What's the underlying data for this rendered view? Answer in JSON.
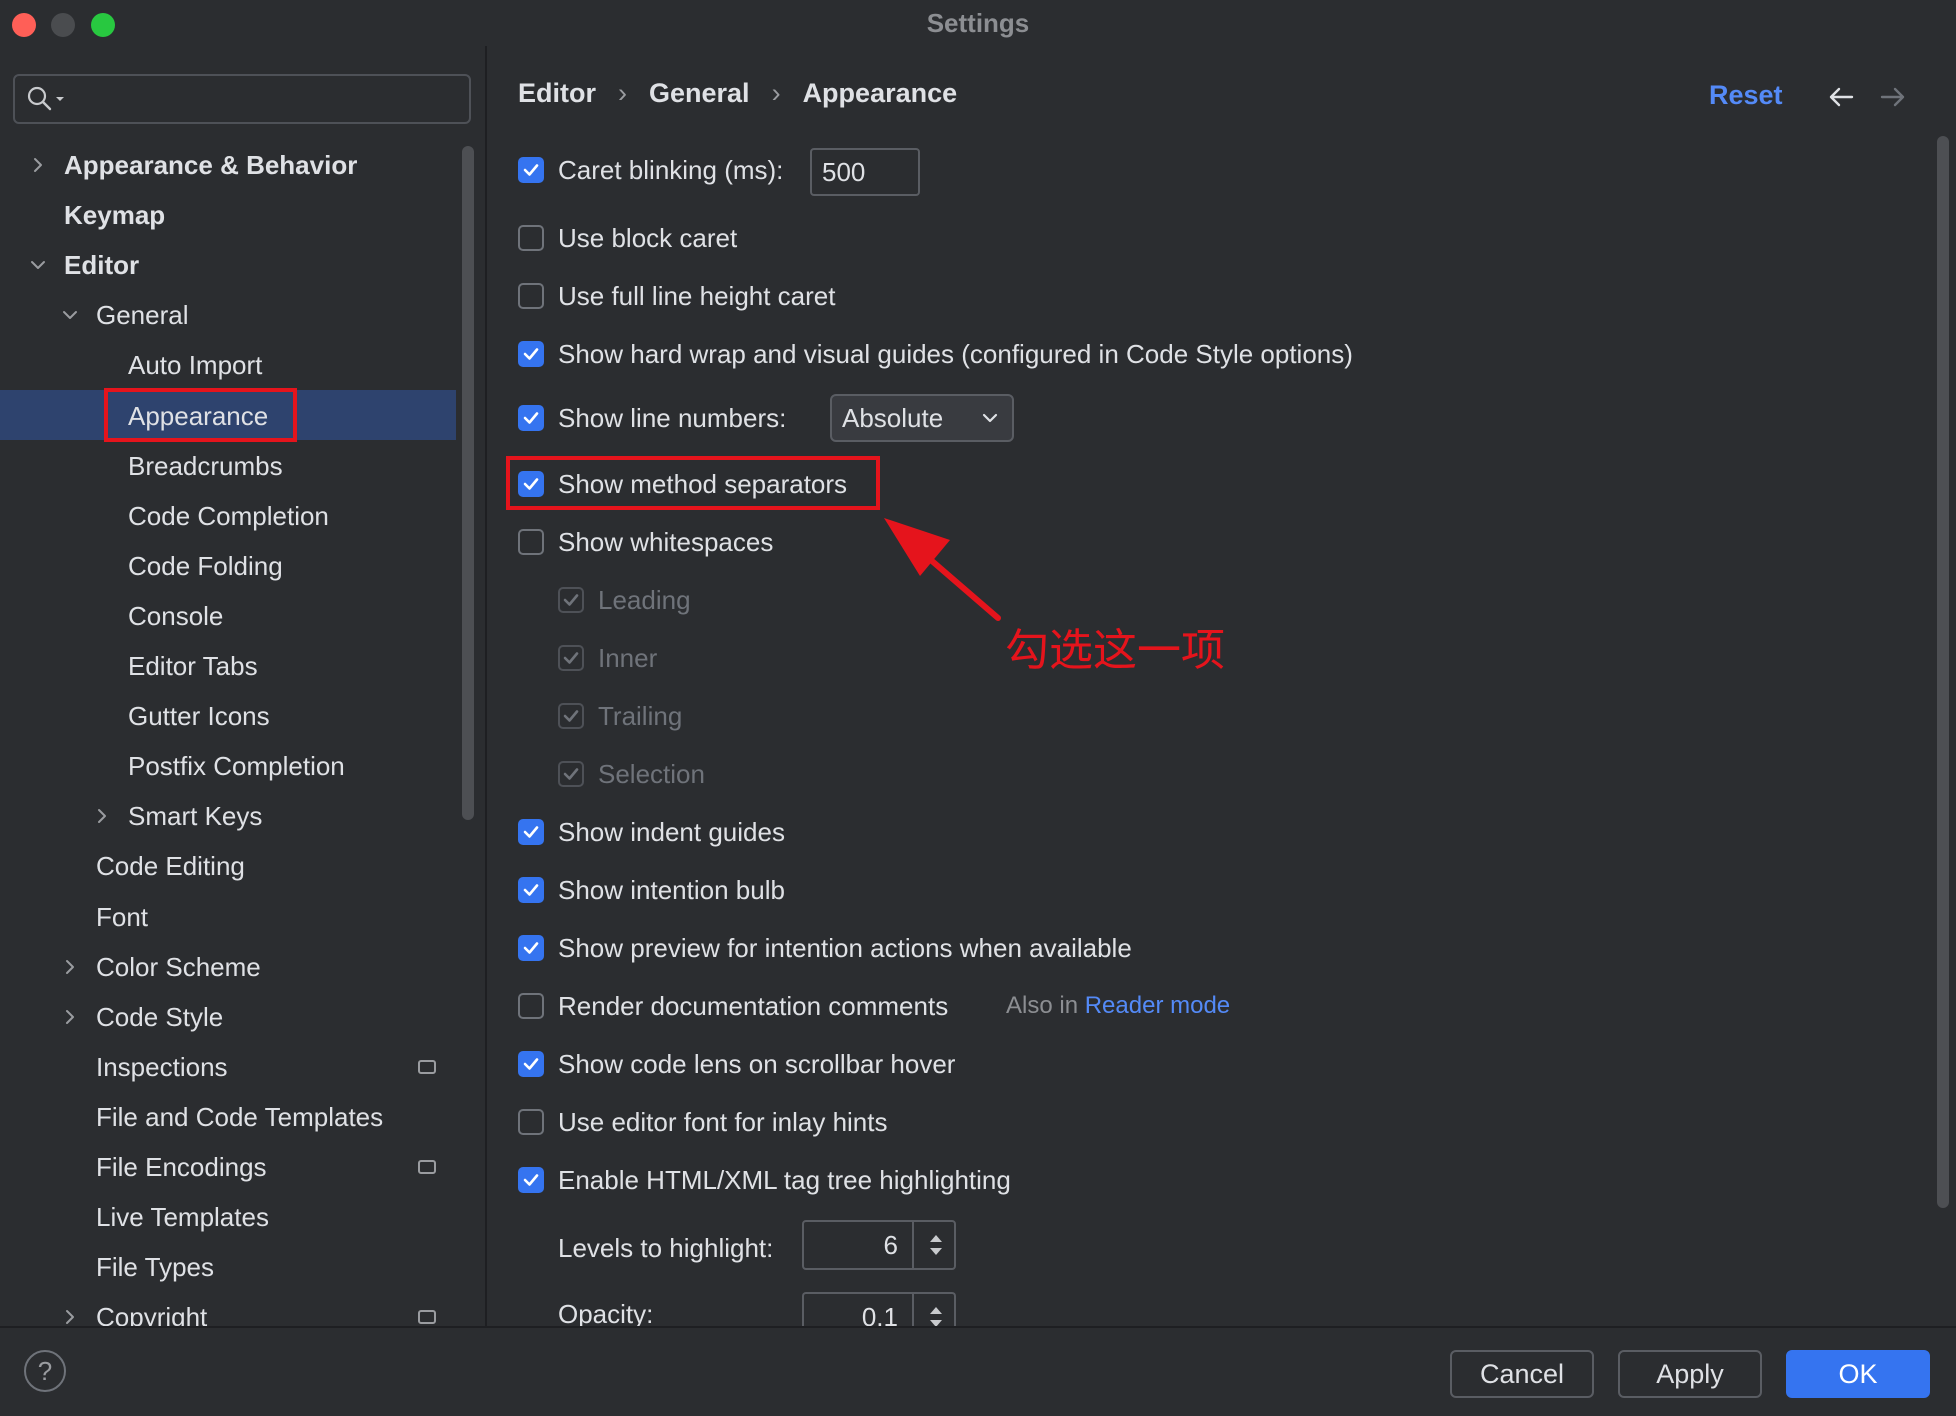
{
  "window": {
    "title": "Settings"
  },
  "search": {
    "placeholder": ""
  },
  "sidebar": {
    "items": [
      {
        "label": "Appearance & Behavior",
        "level": 0,
        "bold": true,
        "expand": "collapsed"
      },
      {
        "label": "Keymap",
        "level": 0,
        "bold": true,
        "expand": "none"
      },
      {
        "label": "Editor",
        "level": 0,
        "bold": true,
        "expand": "expanded"
      },
      {
        "label": "General",
        "level": 1,
        "expand": "expanded"
      },
      {
        "label": "Auto Import",
        "level": 2
      },
      {
        "label": "Appearance",
        "level": 2,
        "selected": true
      },
      {
        "label": "Breadcrumbs",
        "level": 2
      },
      {
        "label": "Code Completion",
        "level": 2
      },
      {
        "label": "Code Folding",
        "level": 2
      },
      {
        "label": "Console",
        "level": 2
      },
      {
        "label": "Editor Tabs",
        "level": 2
      },
      {
        "label": "Gutter Icons",
        "level": 2
      },
      {
        "label": "Postfix Completion",
        "level": 2
      },
      {
        "label": "Smart Keys",
        "level": 2,
        "expand": "collapsed"
      },
      {
        "label": "Code Editing",
        "level": 1
      },
      {
        "label": "Font",
        "level": 1
      },
      {
        "label": "Color Scheme",
        "level": 1,
        "expand": "collapsed"
      },
      {
        "label": "Code Style",
        "level": 1,
        "expand": "collapsed"
      },
      {
        "label": "Inspections",
        "level": 1,
        "badge": true
      },
      {
        "label": "File and Code Templates",
        "level": 1
      },
      {
        "label": "File Encodings",
        "level": 1,
        "badge": true
      },
      {
        "label": "Live Templates",
        "level": 1
      },
      {
        "label": "File Types",
        "level": 1
      },
      {
        "label": "Copyright",
        "level": 1,
        "expand": "collapsed",
        "badge": true
      }
    ]
  },
  "breadcrumb": {
    "items": [
      "Editor",
      "General",
      "Appearance"
    ],
    "separator": "›"
  },
  "header": {
    "reset_label": "Reset",
    "back_icon": "arrow-left-icon",
    "forward_icon": "arrow-right-icon"
  },
  "options": {
    "caret_blinking": {
      "label": "Caret blinking (ms):",
      "checked": true,
      "value": "500"
    },
    "block_caret": {
      "label": "Use block caret",
      "checked": false
    },
    "full_line_caret": {
      "label": "Use full line height caret",
      "checked": false
    },
    "hard_wrap": {
      "label": "Show hard wrap and visual guides (configured in Code Style options)",
      "checked": true
    },
    "line_numbers": {
      "label": "Show line numbers:",
      "checked": true,
      "selected": "Absolute"
    },
    "method_separators": {
      "label": "Show method separators",
      "checked": true
    },
    "whitespaces": {
      "label": "Show whitespaces",
      "checked": false
    },
    "ws_leading": {
      "label": "Leading",
      "checked": true,
      "disabled": true
    },
    "ws_inner": {
      "label": "Inner",
      "checked": true,
      "disabled": true
    },
    "ws_trailing": {
      "label": "Trailing",
      "checked": true,
      "disabled": true
    },
    "ws_selection": {
      "label": "Selection",
      "checked": true,
      "disabled": true
    },
    "indent_guides": {
      "label": "Show indent guides",
      "checked": true
    },
    "intention_bulb": {
      "label": "Show intention bulb",
      "checked": true
    },
    "preview_intention": {
      "label": "Show preview for intention actions when available",
      "checked": true
    },
    "render_docs": {
      "label": "Render documentation comments",
      "checked": false,
      "also_prefix": "Also in",
      "also_link": "Reader mode"
    },
    "code_lens": {
      "label": "Show code lens on scrollbar hover",
      "checked": true
    },
    "editor_font_hints": {
      "label": "Use editor font for inlay hints",
      "checked": false
    },
    "tag_tree": {
      "label": "Enable HTML/XML tag tree highlighting",
      "checked": true
    },
    "levels": {
      "label": "Levels to highlight:",
      "value": "6"
    },
    "opacity": {
      "label": "Opacity:",
      "value": "0.1"
    }
  },
  "annotation": {
    "text": "勾选这一项",
    "color": "#e5141c"
  },
  "footer": {
    "help": "?",
    "cancel": "Cancel",
    "apply": "Apply",
    "ok": "OK"
  },
  "colors": {
    "accent": "#3574f0",
    "link": "#548af7",
    "selection": "#2e436e",
    "background": "#2b2d30",
    "highlight_box": "#e5141c"
  }
}
